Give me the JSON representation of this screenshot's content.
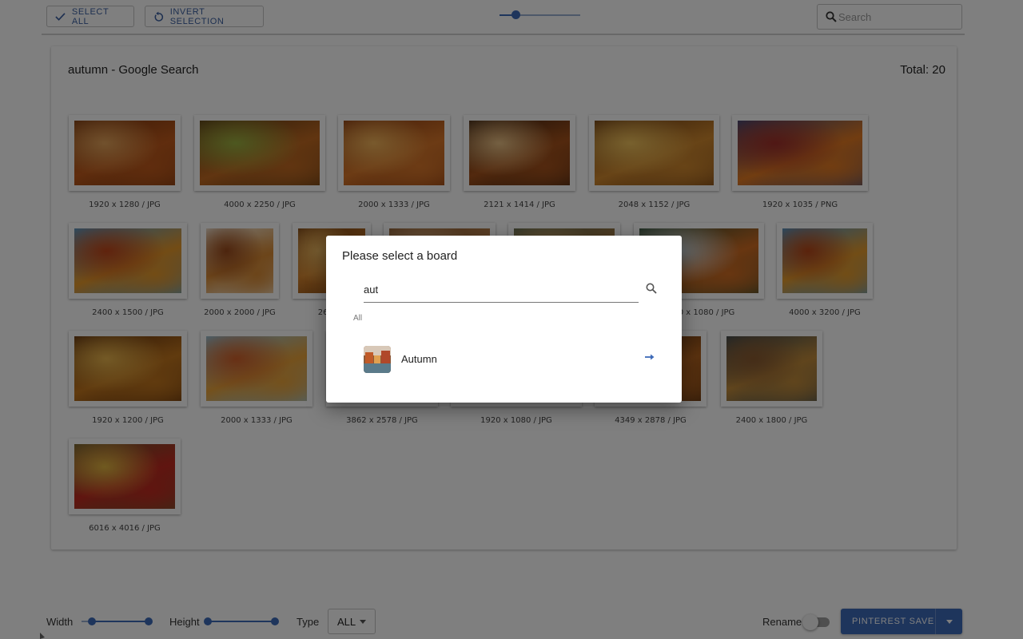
{
  "toolbar": {
    "select_all_label": "SELECT ALL",
    "invert_selection_label": "INVERT SELECTION",
    "zoom_level": 0.2,
    "search_placeholder": "Search"
  },
  "card": {
    "title": "autumn - Google Search",
    "total": "Total: 20"
  },
  "images": [
    {
      "label": "1920 x 1280 / JPG",
      "colors": [
        "#7a3810",
        "#c05a1c",
        "#e3a35a"
      ]
    },
    {
      "label": "4000 x 2250 / JPG",
      "colors": [
        "#5a3a14",
        "#c26a22",
        "#9bb040"
      ]
    },
    {
      "label": "2000 x 1333 / JPG",
      "colors": [
        "#8a3a10",
        "#d9772a",
        "#f2b45a"
      ]
    },
    {
      "label": "2121 x 1414 / JPG",
      "colors": [
        "#3c2210",
        "#a5521c",
        "#e9c084"
      ]
    },
    {
      "label": "2048 x 1152 / JPG",
      "colors": [
        "#6b3a12",
        "#d0882e",
        "#f0c25c"
      ]
    },
    {
      "label": "1920 x 1035 / PNG",
      "colors": [
        "#3c4a7a",
        "#e37a22",
        "#a0302a"
      ]
    },
    {
      "label": "2400 x 1500 / JPG",
      "colors": [
        "#4ea0d6",
        "#e6982a",
        "#c0461a"
      ]
    },
    {
      "label": "2000 x 2000 / JPG",
      "colors": [
        "#f2ede0",
        "#d88a34",
        "#9a4a1c"
      ]
    },
    {
      "label": "2600 x",
      "colors": [
        "#7a4212",
        "#d4822c",
        "#edb860"
      ]
    },
    {
      "label": "",
      "colors": [
        "#8a5a30",
        "#c48a52",
        "#e2b688"
      ]
    },
    {
      "label": "",
      "colors": [
        "#5a6a50",
        "#b07a40",
        "#d0a46a"
      ]
    },
    {
      "label": "1920 x 1080 / JPG",
      "colors": [
        "#2a4a30",
        "#d06c22",
        "#c9d8e0"
      ]
    },
    {
      "label": "4000 x 3200 / JPG",
      "colors": [
        "#4a9ad4",
        "#e49a2c",
        "#b54618"
      ]
    },
    {
      "label": "1920 x 1200 / JPG",
      "colors": [
        "#5a2c0c",
        "#c2761e",
        "#e8b44c"
      ]
    },
    {
      "label": "2000 x 1333 / JPG",
      "colors": [
        "#8fc8e6",
        "#e8a23a",
        "#d0602a"
      ]
    },
    {
      "label": "3862 x 2578 / JPG",
      "colors": [
        "#6a3a14",
        "#c27a30",
        "#e4b070"
      ]
    },
    {
      "label": "1920 x 1080 / JPG",
      "colors": [
        "#5a3a1c",
        "#b46a2a",
        "#e0a060"
      ]
    },
    {
      "label": "4349 x 2878 / JPG",
      "colors": [
        "#4a2a12",
        "#b2621e",
        "#dc9c50"
      ]
    },
    {
      "label": "2400 x 1800 / JPG",
      "colors": [
        "#3a4a52",
        "#c08a3a",
        "#8a5a30"
      ]
    },
    {
      "label": "6016 x 4016 / JPG",
      "colors": [
        "#6a5a30",
        "#c02a20",
        "#e0b440"
      ]
    }
  ],
  "bottom": {
    "width_label": "Width",
    "width_range": [
      0.15,
      1.0
    ],
    "height_label": "Height",
    "height_range": [
      0.0,
      1.0
    ],
    "type_label": "Type",
    "type_value": "ALL",
    "rename_label": "Rename",
    "rename_on": false,
    "save_label": "PINTEREST SAVE"
  },
  "dialog": {
    "title": "Please select a board",
    "search_value": "aut",
    "section_label": "All",
    "boards": [
      {
        "name": "Autumn"
      }
    ]
  },
  "colors": {
    "accent": "#3d6ab8",
    "overlay": "rgba(0,0,0,0.5)"
  }
}
